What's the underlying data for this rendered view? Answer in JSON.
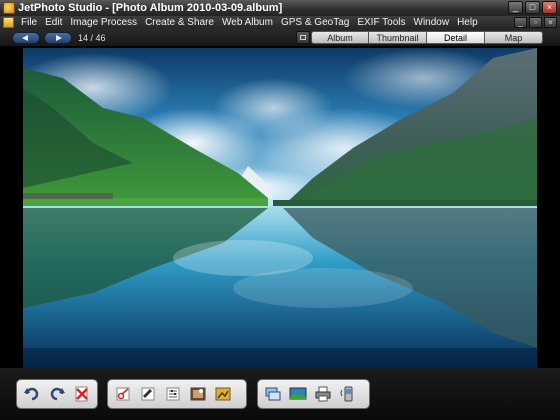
{
  "window": {
    "title": "JetPhoto Studio - [Photo Album 2010-03-09.album]",
    "controls": {
      "minimize": "_",
      "maximize": "□",
      "close": "×"
    }
  },
  "menubar": {
    "items": [
      "File",
      "Edit",
      "Image Process",
      "Create & Share",
      "Web Album",
      "GPS & GeoTag",
      "EXIF Tools",
      "Window",
      "Help"
    ],
    "mdi_controls": {
      "minimize": "_",
      "restore": "▫",
      "close": "×"
    }
  },
  "navigation": {
    "counter": "14 / 46",
    "tabs": [
      "Album",
      "Thumbnail",
      "Detail",
      "Map"
    ],
    "active_tab": "Detail"
  },
  "toolbar": {
    "groups": [
      {
        "name": "edit",
        "icons": [
          "undo-icon",
          "redo-icon",
          "delete-icon"
        ]
      },
      {
        "name": "adjust",
        "icons": [
          "crop-icon",
          "rotate-icon",
          "adjust-icon",
          "enhance-icon",
          "effects-icon"
        ]
      },
      {
        "name": "share",
        "icons": [
          "slideshow-icon",
          "wallpaper-icon",
          "print-icon",
          "mobile-icon"
        ]
      }
    ]
  },
  "colors": {
    "accent": "#2a4a78",
    "tab_active": "#ffffff",
    "title_bar": "#2f2f2f"
  }
}
